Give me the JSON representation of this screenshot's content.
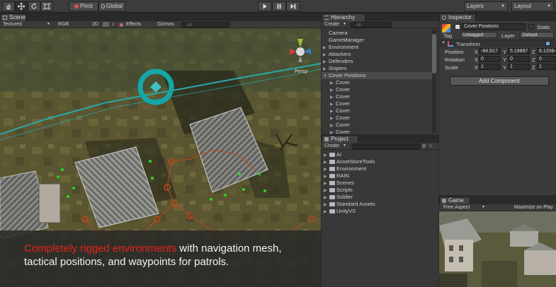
{
  "toolbar": {
    "pivot_label": "Pivot",
    "global_label": "Global",
    "layers_label": "Layers",
    "layout_label": "Layout"
  },
  "scene": {
    "tab_label": "Scene",
    "shading_mode": "Textured",
    "render_mode": "RGB",
    "mode_2d": "2D",
    "effects_label": "Effects",
    "gizmos_label": "Gizmos",
    "search_placeholder": "All",
    "persp_label": "Persp"
  },
  "caption": {
    "highlight": "Completely rigged environments",
    "line1_rest": " with navigation mesh,",
    "line2": "tactical positions, and waypoints for patrols."
  },
  "hierarchy": {
    "tab_label": "Hierarchy",
    "create_label": "Create",
    "search_placeholder": "All",
    "items": [
      {
        "label": "Camera",
        "expandable": false,
        "indent": 0,
        "selected": false
      },
      {
        "label": "GameManager",
        "expandable": false,
        "indent": 0,
        "selected": false
      },
      {
        "label": "Environment",
        "expandable": true,
        "indent": 0,
        "selected": false
      },
      {
        "label": "Attackers",
        "expandable": true,
        "indent": 0,
        "selected": false
      },
      {
        "label": "Defenders",
        "expandable": true,
        "indent": 0,
        "selected": false
      },
      {
        "label": "Snipers",
        "expandable": true,
        "indent": 0,
        "selected": false
      },
      {
        "label": "Cover Positions",
        "expandable": true,
        "indent": 0,
        "selected": true
      },
      {
        "label": "Cover",
        "expandable": true,
        "indent": 1,
        "selected": false
      },
      {
        "label": "Cover",
        "expandable": true,
        "indent": 1,
        "selected": false
      },
      {
        "label": "Cover",
        "expandable": true,
        "indent": 1,
        "selected": false
      },
      {
        "label": "Cover",
        "expandable": true,
        "indent": 1,
        "selected": false
      },
      {
        "label": "Cover",
        "expandable": true,
        "indent": 1,
        "selected": false
      },
      {
        "label": "Cover",
        "expandable": true,
        "indent": 1,
        "selected": false
      },
      {
        "label": "Cover",
        "expandable": true,
        "indent": 1,
        "selected": false
      },
      {
        "label": "Cover",
        "expandable": true,
        "indent": 1,
        "selected": false
      }
    ]
  },
  "project": {
    "tab_label": "Project",
    "create_label": "Create",
    "folders": [
      "AI",
      "AssetStoreTools",
      "Environment",
      "RAIN",
      "Scenes",
      "Scripts",
      "Soldier",
      "Standard Assets",
      "UnityVS"
    ]
  },
  "inspector": {
    "tab_label": "Inspector",
    "object_name": "Cover Positions",
    "static_label": "Static",
    "tag_label": "Tag",
    "tag_value": "Untagged",
    "layer_label": "Layer",
    "layer_value": "Default",
    "transform_label": "Transform",
    "position_label": "Position",
    "rotation_label": "Rotation",
    "scale_label": "Scale",
    "position": {
      "x": "-64.917",
      "y": "5.19897",
      "z": "6.12064"
    },
    "rotation": {
      "x": "0",
      "y": "0",
      "z": "0"
    },
    "scale": {
      "x": "1",
      "y": "1",
      "z": "1"
    },
    "axis_x": "X",
    "axis_y": "Y",
    "axis_z": "Z",
    "add_component_label": "Add Component"
  },
  "game": {
    "tab_label": "Game",
    "aspect_label": "Free Aspect",
    "maximize_label": "Maximize on Play"
  },
  "colors": {
    "caption_highlight": "#e8221a",
    "navmesh": "#2aa8a8",
    "waypoint_green": "#28d828",
    "waypoint_orange": "#c0481c"
  }
}
